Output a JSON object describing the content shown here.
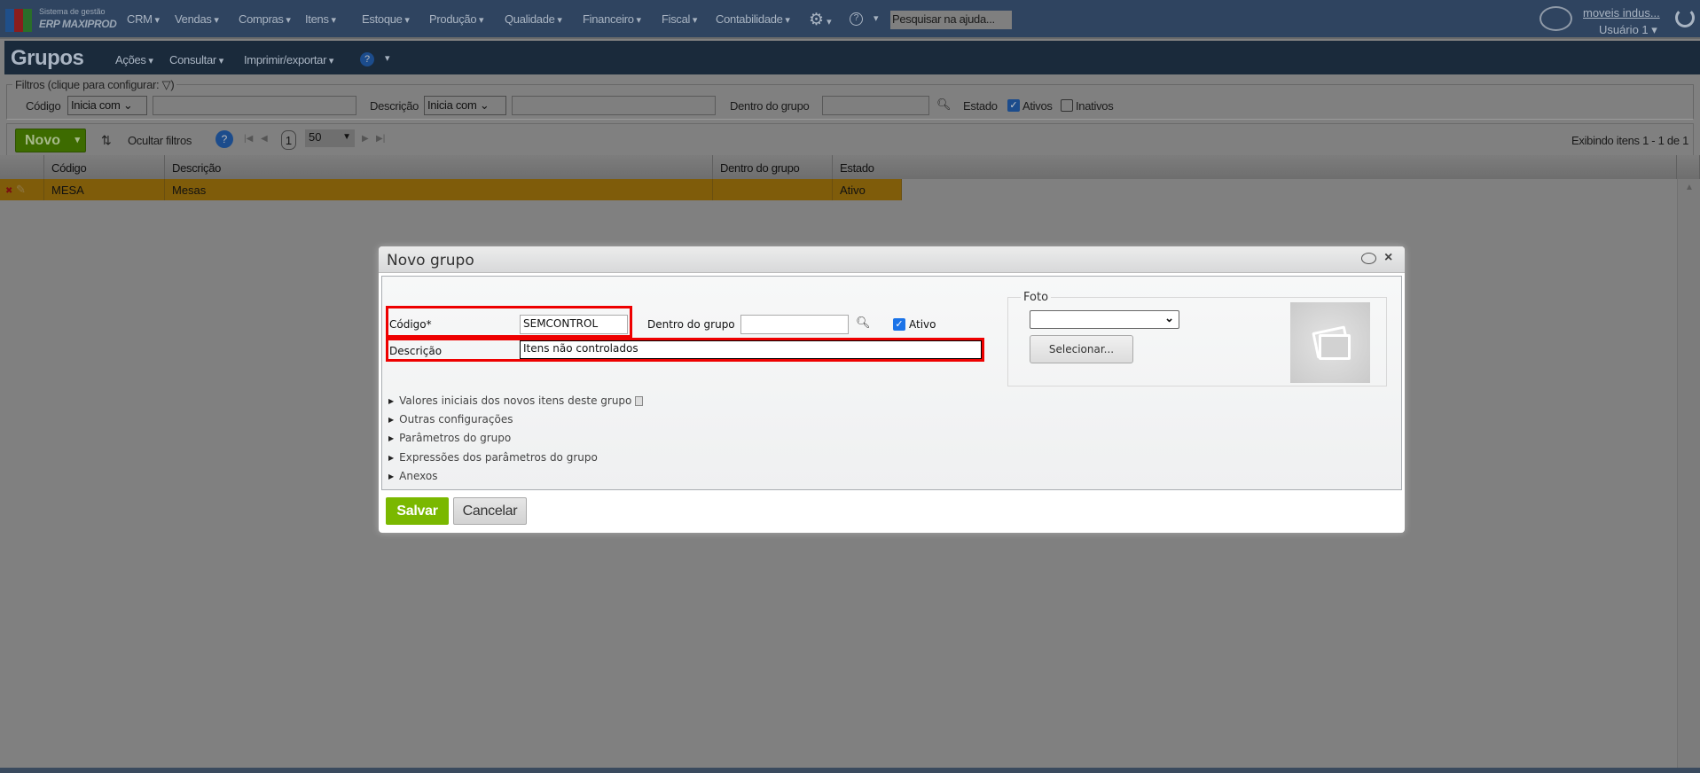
{
  "topbar": {
    "logo_line1": "Sistema de gestão",
    "logo_line2": "ERP MAXIPROD",
    "menu": [
      "CRM",
      "Vendas",
      "Compras",
      "Itens",
      "Estoque",
      "Produção",
      "Qualidade",
      "Financeiro",
      "Fiscal",
      "Contabilidade"
    ],
    "help_search_value": "Pesquisar na ajuda...",
    "company": "moveis indus...",
    "user": "Usuário 1"
  },
  "page": {
    "title": "Grupos",
    "menu": [
      "Ações",
      "Consultar",
      "Imprimir/exportar"
    ]
  },
  "filters": {
    "legend": "Filtros (clique para configurar:",
    "legend_end": ")",
    "codigo_label": "Código",
    "codigo_op": "Inicia com",
    "descricao_label": "Descrição",
    "descricao_op": "Inicia com",
    "grupo_label": "Dentro do grupo",
    "estado_label": "Estado",
    "ativos_label": "Ativos",
    "ativos_checked": true,
    "inativos_label": "Inativos",
    "inativos_checked": false
  },
  "toolbar": {
    "new_label": "Novo",
    "hide_filters": "Ocultar filtros",
    "page": "1",
    "page_size": "50",
    "status": "Exibindo itens 1 - 1 de 1"
  },
  "grid": {
    "columns": [
      "Código",
      "Descrição",
      "Dentro do grupo",
      "Estado"
    ],
    "rows": [
      {
        "codigo": "MESA",
        "descricao": "Mesas",
        "grupo": "",
        "estado": "Ativo"
      }
    ]
  },
  "dialog": {
    "title": "Novo grupo",
    "codigo_label": "Código*",
    "codigo_value": "SEMCONTROL",
    "grupo_label": "Dentro do grupo",
    "ativo_label": "Ativo",
    "ativo_checked": true,
    "descricao_label": "Descrição",
    "descricao_value": "Itens não controlados",
    "foto_legend": "Foto",
    "foto_select": "",
    "select_button": "Selecionar...",
    "sections": [
      "Valores iniciais dos novos itens deste grupo",
      "Outras configurações",
      "Parâmetros do grupo",
      "Expressões dos parâmetros do grupo",
      "Anexos"
    ],
    "save": "Salvar",
    "cancel": "Cancelar"
  },
  "colors": {
    "save_green": "#7ab800",
    "highlight_red": "#ee0000",
    "selected_row": "#7f5c0a"
  }
}
